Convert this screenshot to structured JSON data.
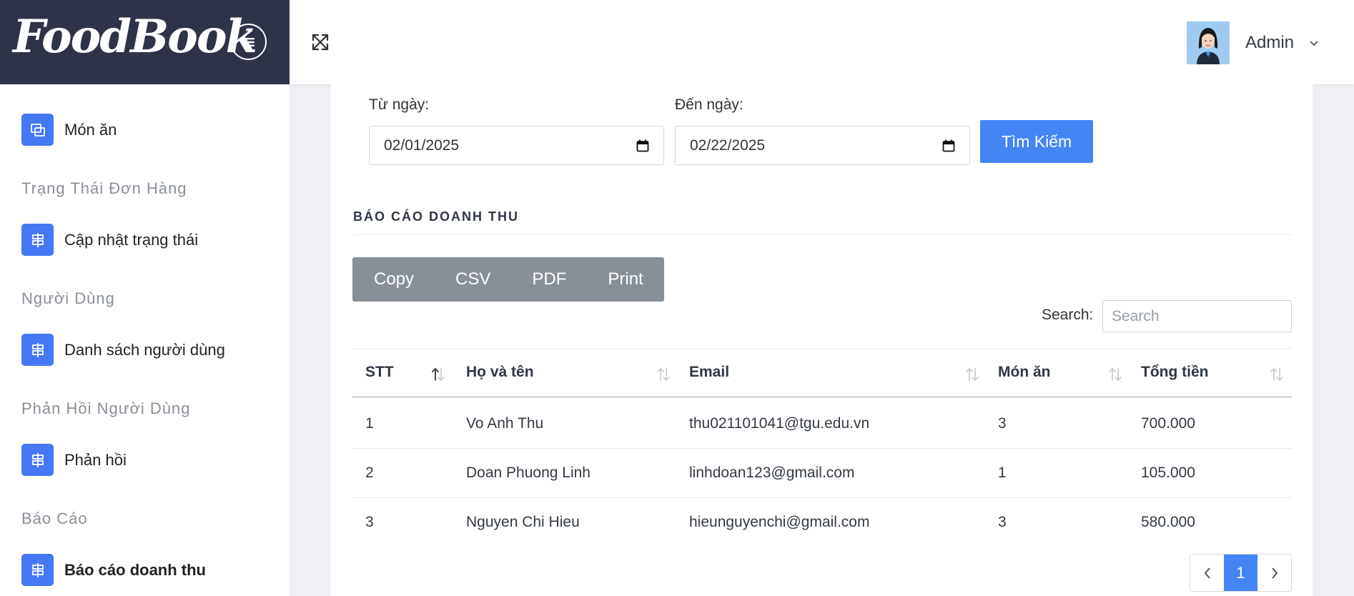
{
  "brand": {
    "logo_text": "FoodBook"
  },
  "header": {
    "user_name": "Admin"
  },
  "sidebar": {
    "items": [
      {
        "type": "item",
        "label": "Món ăn",
        "icon": "copy-icon"
      },
      {
        "type": "heading",
        "label": "Trạng Thái Đơn Hàng"
      },
      {
        "type": "item",
        "label": "Cập nhật trạng thái",
        "icon": "signpost-icon"
      },
      {
        "type": "heading",
        "label": "Người Dùng"
      },
      {
        "type": "item",
        "label": "Danh sách người dùng",
        "icon": "signpost-icon"
      },
      {
        "type": "heading",
        "label": "Phản Hồi Người Dùng"
      },
      {
        "type": "item",
        "label": "Phản hồi",
        "icon": "signpost-icon"
      },
      {
        "type": "heading",
        "label": "Báo Cáo"
      },
      {
        "type": "item",
        "label": "Báo cáo doanh thu",
        "icon": "signpost-icon",
        "active": true
      }
    ]
  },
  "filter": {
    "from_label": "Từ ngày:",
    "from_value": "02/01/2025",
    "to_label": "Đến ngày:",
    "to_value": "02/22/2025",
    "search_button": "Tìm Kiếm"
  },
  "report": {
    "title": "BÁO CÁO DOANH THU",
    "export_buttons": [
      "Copy",
      "CSV",
      "PDF",
      "Print"
    ],
    "search_label": "Search:",
    "search_placeholder": "Search",
    "columns": [
      "STT",
      "Họ và tên",
      "Email",
      "Món ăn",
      "Tổng tiền"
    ],
    "rows": [
      [
        "1",
        "Vo Anh Thu",
        "thu021101041@tgu.edu.vn",
        "3",
        "700.000"
      ],
      [
        "2",
        "Doan Phuong Linh",
        "linhdoan123@gmail.com",
        "1",
        "105.000"
      ],
      [
        "3",
        "Nguyen Chi Hieu",
        "hieunguyenchi@gmail.com",
        "3",
        "580.000"
      ]
    ],
    "pagination": {
      "current_page": "1"
    }
  },
  "colors": {
    "accent": "#4485f5",
    "brand_bg": "#2e3348",
    "export_bg": "#878f97"
  }
}
